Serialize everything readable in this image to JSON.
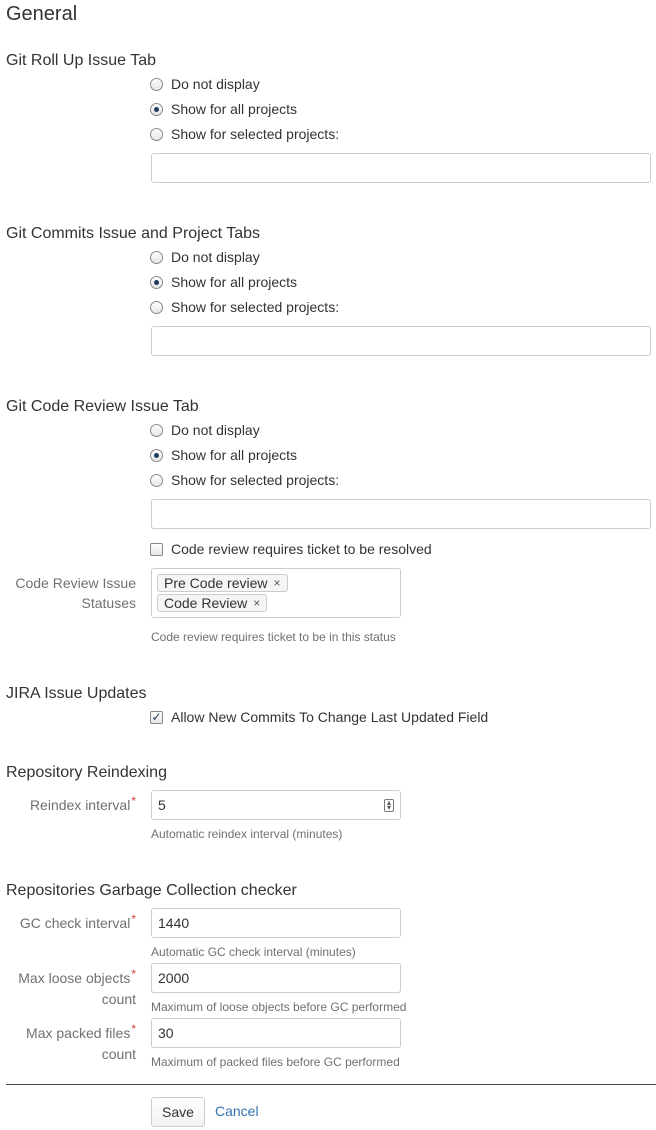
{
  "page_title": "General",
  "sections": {
    "rollup": {
      "title": "Git Roll Up Issue Tab",
      "options": [
        "Do not display",
        "Show for all projects",
        "Show for selected projects:"
      ],
      "selected": 1
    },
    "commits": {
      "title": "Git Commits Issue and Project Tabs",
      "options": [
        "Do not display",
        "Show for all projects",
        "Show for selected projects:"
      ],
      "selected": 1
    },
    "review": {
      "title": "Git Code Review Issue Tab",
      "options": [
        "Do not display",
        "Show for all projects",
        "Show for selected projects:"
      ],
      "selected": 1,
      "require_resolved_label": "Code review requires ticket to be resolved",
      "require_resolved_checked": false,
      "statuses_label_line1": "Code Review Issue",
      "statuses_label_line2": "Statuses",
      "statuses": [
        "Pre Code review",
        "Code Review"
      ],
      "remove_glyph": "×",
      "statuses_help": "Code review requires ticket to be in this status"
    },
    "jira": {
      "title": "JIRA Issue Updates",
      "allow_label": "Allow New Commits To Change Last Updated Field",
      "allow_checked": true,
      "check_glyph": "✓"
    },
    "reindex": {
      "title": "Repository Reindexing",
      "interval_label": "Reindex interval",
      "interval_value": "5",
      "interval_help": "Automatic reindex interval (minutes)"
    },
    "gc": {
      "title": "Repositories Garbage Collection checker",
      "check_label": "GC check interval",
      "check_value": "1440",
      "check_help": "Automatic GC check interval (minutes)",
      "loose_label_line1": "Max loose objects",
      "loose_label_line2": "count",
      "loose_value": "2000",
      "loose_help": "Maximum of loose objects before GC performed",
      "packed_label_line1": "Max packed files",
      "packed_label_line2": "count",
      "packed_value": "30",
      "packed_help": "Maximum of packed files before GC performed"
    }
  },
  "required_mark": "*",
  "actions": {
    "save": "Save",
    "cancel": "Cancel"
  },
  "colors": {
    "link": "#3572b0",
    "required": "#d04437",
    "label": "#707070"
  }
}
